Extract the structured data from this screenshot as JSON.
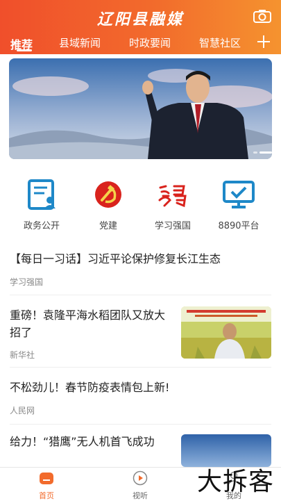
{
  "header": {
    "app_title": "辽阳县融媒",
    "tabs": [
      {
        "label": "推荐",
        "active": true
      },
      {
        "label": "县域新闻",
        "active": false
      },
      {
        "label": "时政要闻",
        "active": false
      },
      {
        "label": "智慧社区",
        "active": false
      }
    ],
    "icons": {
      "camera": "camera-icon",
      "add": "plus-icon"
    }
  },
  "banner": {
    "slides": 2,
    "current": 1
  },
  "quick_links": [
    {
      "label": "政务公开",
      "icon": "document-icon",
      "color": "#1e88c8"
    },
    {
      "label": "党建",
      "icon": "party-emblem-icon",
      "color": "#d9231d"
    },
    {
      "label": "学习强国",
      "icon": "xuexi-logo-icon",
      "color": "#d9231d"
    },
    {
      "label": "8890平台",
      "icon": "monitor-icon",
      "color": "#1e88c8"
    }
  ],
  "news": [
    {
      "title": "【每日一习话】习近平论保护修复长江生态",
      "source": "学习强国"
    },
    {
      "title": "重磅！袁隆平海水稻团队又放大招了",
      "source": "新华社"
    },
    {
      "title": "不松劲儿！春节防疫表情包上新!",
      "source": "人民网"
    },
    {
      "title": "给力！“猎鹰”无人机首飞成功",
      "source": ""
    }
  ],
  "bottom_nav": [
    {
      "label": "首页",
      "icon": "home-icon",
      "active": true
    },
    {
      "label": "视听",
      "icon": "play-icon",
      "active": false
    },
    {
      "label": "我的",
      "icon": "user-icon",
      "active": false
    }
  ],
  "watermark": "大拆客",
  "colors": {
    "brand": "#f26b2c",
    "text": "#222222",
    "muted": "#888888"
  }
}
